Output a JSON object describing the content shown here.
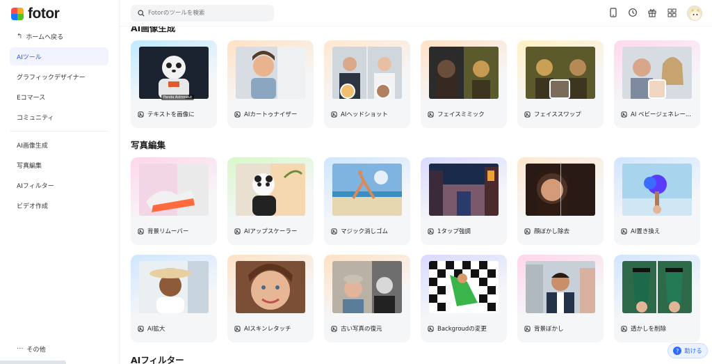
{
  "app": {
    "logo_text": "fotor"
  },
  "sidebar": {
    "back_label": "ホームへ戻る",
    "items": [
      {
        "label": "AIツール",
        "active": true
      },
      {
        "label": "グラフィックデザイナー"
      },
      {
        "label": "Eコマース"
      },
      {
        "label": "コミュニティ"
      }
    ],
    "items2": [
      {
        "label": "AI画像生成"
      },
      {
        "label": "写真編集"
      },
      {
        "label": "AIフィルター"
      },
      {
        "label": "ビデオ作成"
      }
    ],
    "more_label": "その他"
  },
  "header": {
    "search_placeholder": "Fotorのツールを検索",
    "icons": [
      "mobile-icon",
      "history-icon",
      "gift-icon",
      "apps-grid-icon"
    ]
  },
  "sections": [
    {
      "title": "AI画像生成",
      "cards": [
        {
          "label": "テキストを画像に",
          "icon": "text-to-image-icon",
          "thumb_caption": "Panda Astronaut"
        },
        {
          "label": "AIカートゥナイザー",
          "icon": "image-icon"
        },
        {
          "label": "AIヘッドショット",
          "icon": "person-icon"
        },
        {
          "label": "フェイスミミック",
          "icon": "face-scan-icon"
        },
        {
          "label": "フェイススワップ",
          "icon": "swap-icon"
        },
        {
          "label": "AI ベビージェネレー...",
          "icon": "baby-icon"
        }
      ]
    },
    {
      "title": "写真編集",
      "cards": [
        {
          "label": "背景リムーバー",
          "icon": "bg-remove-icon"
        },
        {
          "label": "AIアップスケーラー",
          "icon": "upscale-icon"
        },
        {
          "label": "マジック消しゴム",
          "icon": "eraser-icon"
        },
        {
          "label": "1タップ強調",
          "icon": "enhance-icon"
        },
        {
          "label": "顔ぼかし除去",
          "icon": "face-icon"
        },
        {
          "label": "AI置き換え",
          "icon": "replace-icon"
        }
      ]
    },
    {
      "title": "",
      "cards": [
        {
          "label": "AI拡大",
          "icon": "expand-icon"
        },
        {
          "label": "AIスキンレタッチ",
          "icon": "retouch-icon"
        },
        {
          "label": "古い写真の復元",
          "icon": "restore-icon"
        },
        {
          "label": "Backgroudの変更",
          "icon": "change-bg-icon"
        },
        {
          "label": "背景ぼかし",
          "icon": "blur-icon"
        },
        {
          "label": "透かしを削除",
          "icon": "watermark-icon"
        }
      ]
    },
    {
      "title": "AIフィルター"
    }
  ],
  "help": {
    "label": "助ける"
  },
  "colors": {
    "accent": "#2f54eb",
    "active_bg": "#f1f4ff",
    "card_bg": "#f5f6f8"
  }
}
